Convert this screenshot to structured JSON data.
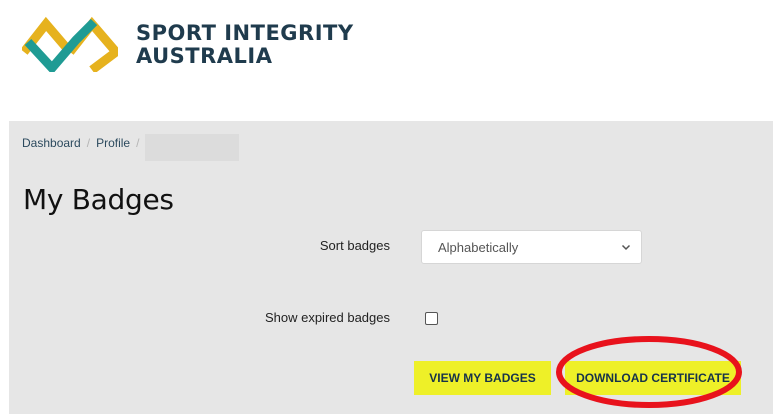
{
  "header": {
    "logo_line1": "SPORT INTEGRITY",
    "logo_line2": "AUSTRALIA",
    "logo_colors": {
      "gold": "#e6b21e",
      "teal": "#1f9b94",
      "text": "#1f3b4d"
    }
  },
  "breadcrumb": {
    "items": [
      {
        "label": "Dashboard"
      },
      {
        "label": "Profile"
      }
    ],
    "separator": "/"
  },
  "page": {
    "title": "My Badges"
  },
  "form": {
    "sort_label": "Sort badges",
    "sort_value": "Alphabetically",
    "expired_label": "Show expired badges",
    "expired_checked": false
  },
  "actions": {
    "view_label": "VIEW MY BADGES",
    "download_label": "DOWNLOAD CERTIFICATE",
    "button_color": "#eef028"
  },
  "annotation": {
    "color": "#e8121c"
  }
}
